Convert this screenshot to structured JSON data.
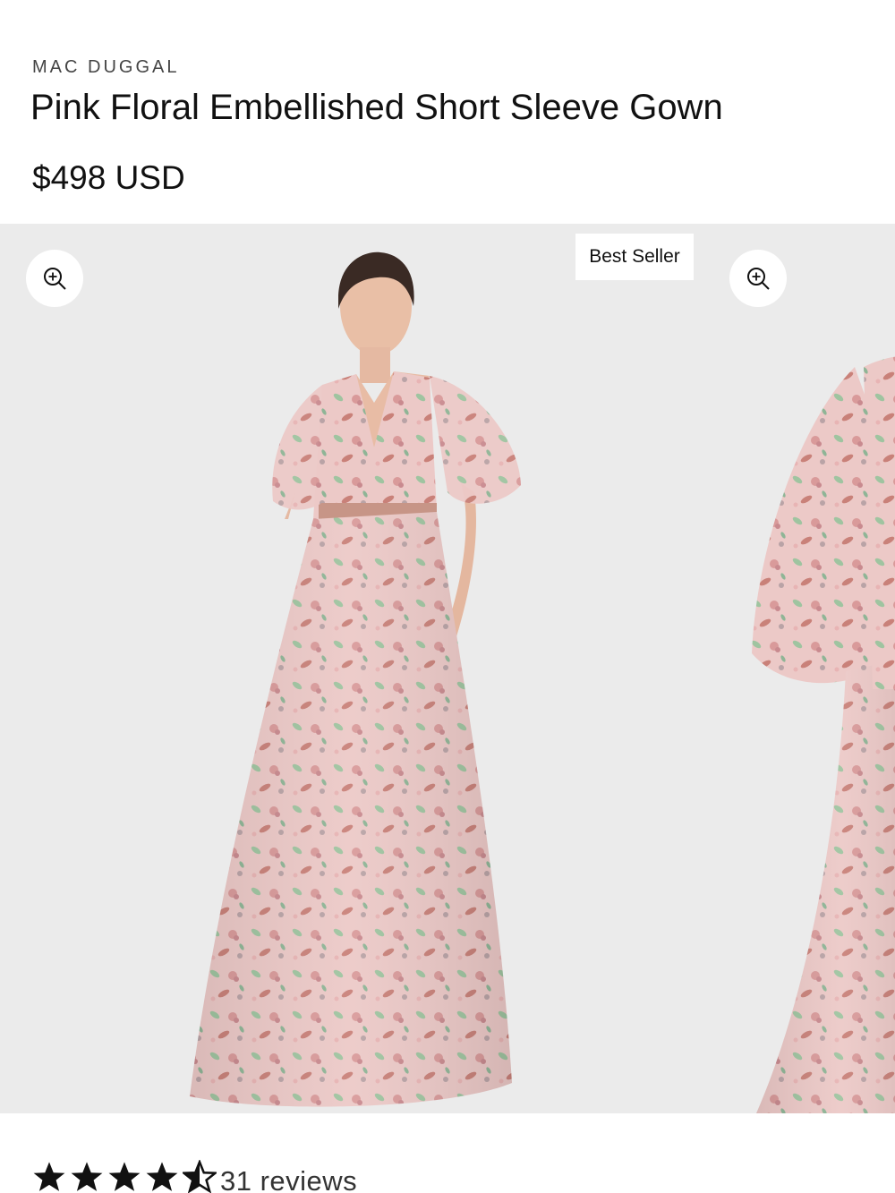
{
  "product": {
    "brand": "MAC DUGGAL",
    "title": "Pink Floral Embellished Short Sleeve Gown",
    "price": "$498 USD"
  },
  "gallery": {
    "badge": "Best Seller",
    "zoom_icon": "zoom-in-icon",
    "background": "#ebebeb",
    "dress_color": "#ecc8c6"
  },
  "reviews": {
    "rating": 4.5,
    "max": 5,
    "count_label": "31 reviews"
  }
}
